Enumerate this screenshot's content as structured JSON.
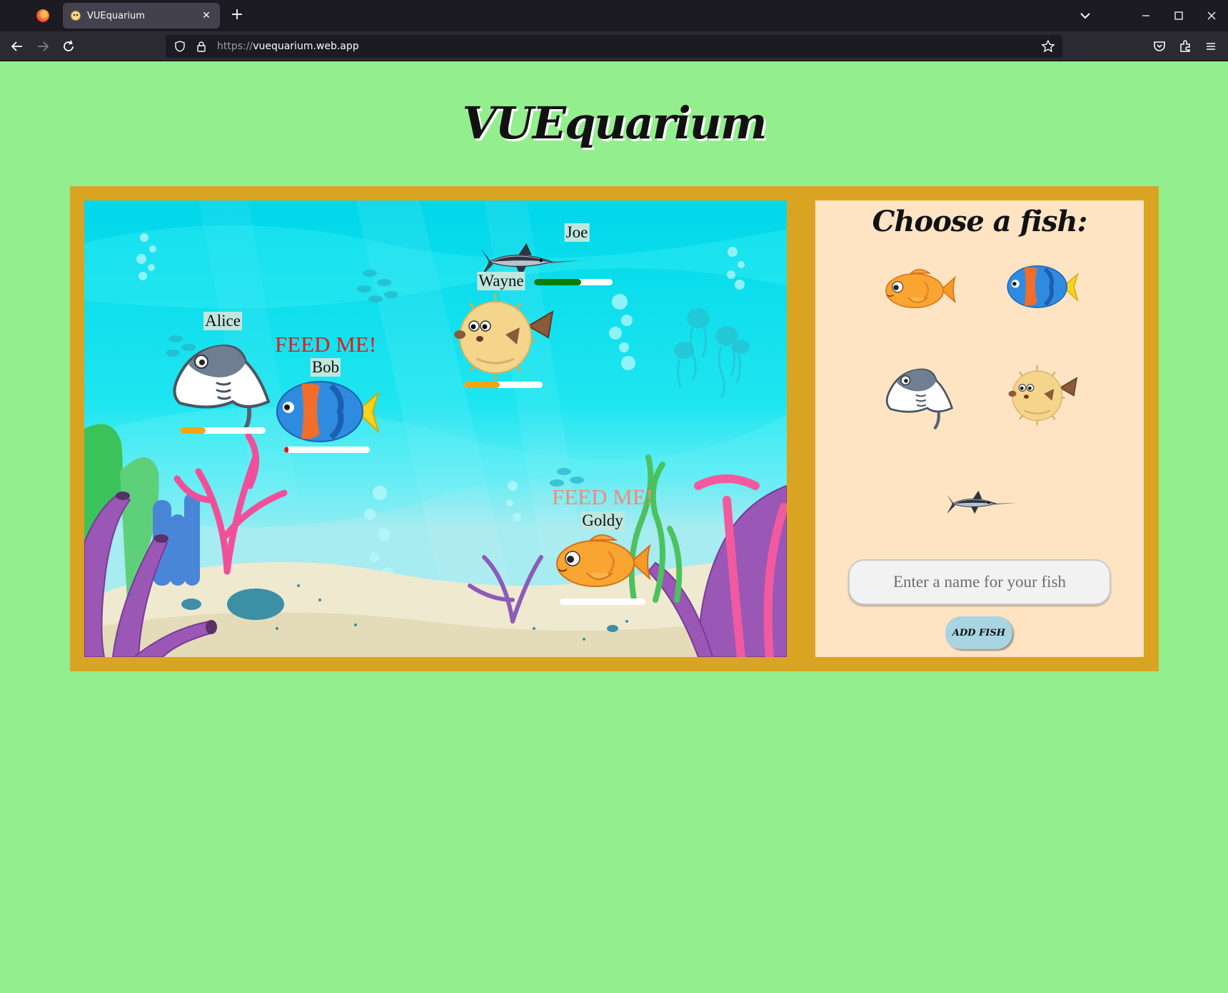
{
  "browser": {
    "tab_title": "VUEquarium",
    "url_protocol": "https://",
    "url_host": "vuequarium.web.app"
  },
  "page": {
    "title": "VUEquarium"
  },
  "aquarium": {
    "fish": [
      {
        "name": "Joe",
        "species": "swordfish",
        "hunger": 0.6,
        "hunger_color": "#0a7d0a",
        "feed_message": ""
      },
      {
        "name": "Wayne",
        "species": "pufferfish",
        "hunger": 0.45,
        "hunger_color": "#f2a413",
        "feed_message": ""
      },
      {
        "name": "Alice",
        "species": "stingray",
        "hunger": 0.3,
        "hunger_color": "#f2a413",
        "feed_message": ""
      },
      {
        "name": "Bob",
        "species": "blue tang",
        "hunger": 0.05,
        "hunger_color": "#e01b1b",
        "feed_message": "FEED ME!"
      },
      {
        "name": "Goldy",
        "species": "goldfish",
        "hunger": 0.0,
        "hunger_color": "#e01b1b",
        "feed_message": "FEED ME!"
      }
    ]
  },
  "panel": {
    "title": "Choose a fish:",
    "choices": [
      "goldfish",
      "blue tang",
      "stingray",
      "pufferfish",
      "swordfish"
    ],
    "name_placeholder": "Enter a name for your fish",
    "name_value": "",
    "add_button_label": "ADD FISH"
  },
  "colors": {
    "page_background": "#93ee8e",
    "frame": "#d9a421",
    "panel_background": "#ffe4c4",
    "water": "#00d7ea",
    "feed_alert": "#dd1c1c"
  }
}
